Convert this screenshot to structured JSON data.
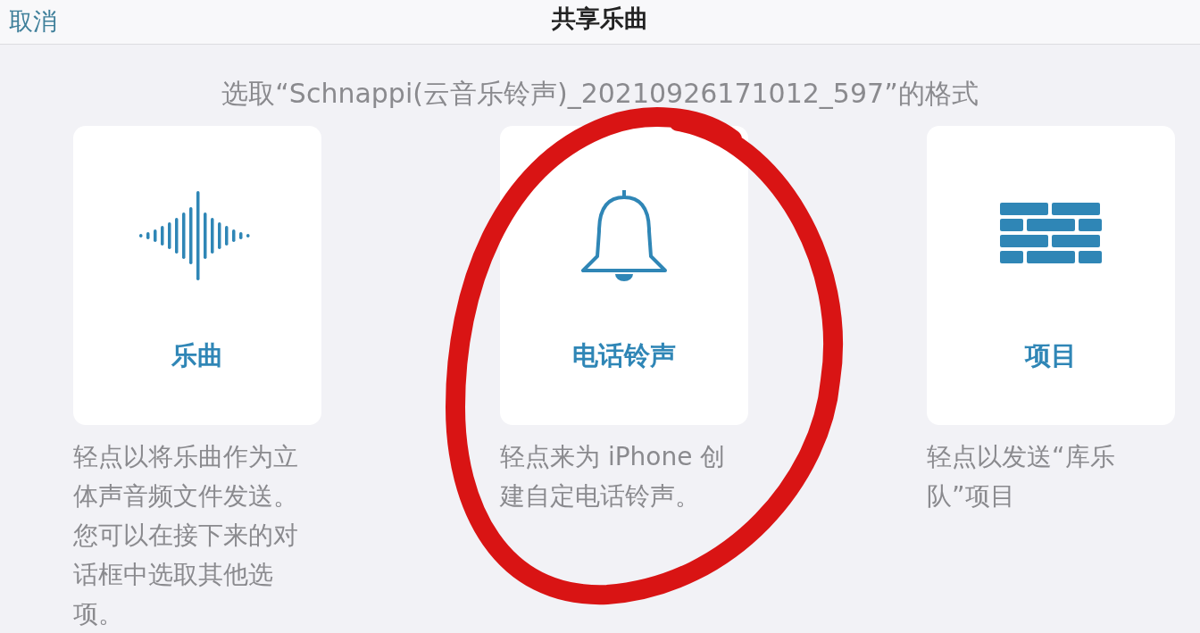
{
  "nav_bar": {
    "cancel": "取消",
    "title": "共享乐曲"
  },
  "subtitle": "选取“Schnappi(云音乐铃声)_20210926171012_597”的格式",
  "options": [
    {
      "kind": "song",
      "label": "乐曲",
      "description": "轻点以将乐曲作为立体声音频文件发送。您可以在接下来的对话框中选取其他选项。"
    },
    {
      "kind": "ringtone",
      "label": "电话铃声",
      "description": "轻点来为 iPhone 创建自定电话铃声。"
    },
    {
      "kind": "project",
      "label": "项目",
      "description": "轻点以发送“库乐队”项目"
    }
  ]
}
